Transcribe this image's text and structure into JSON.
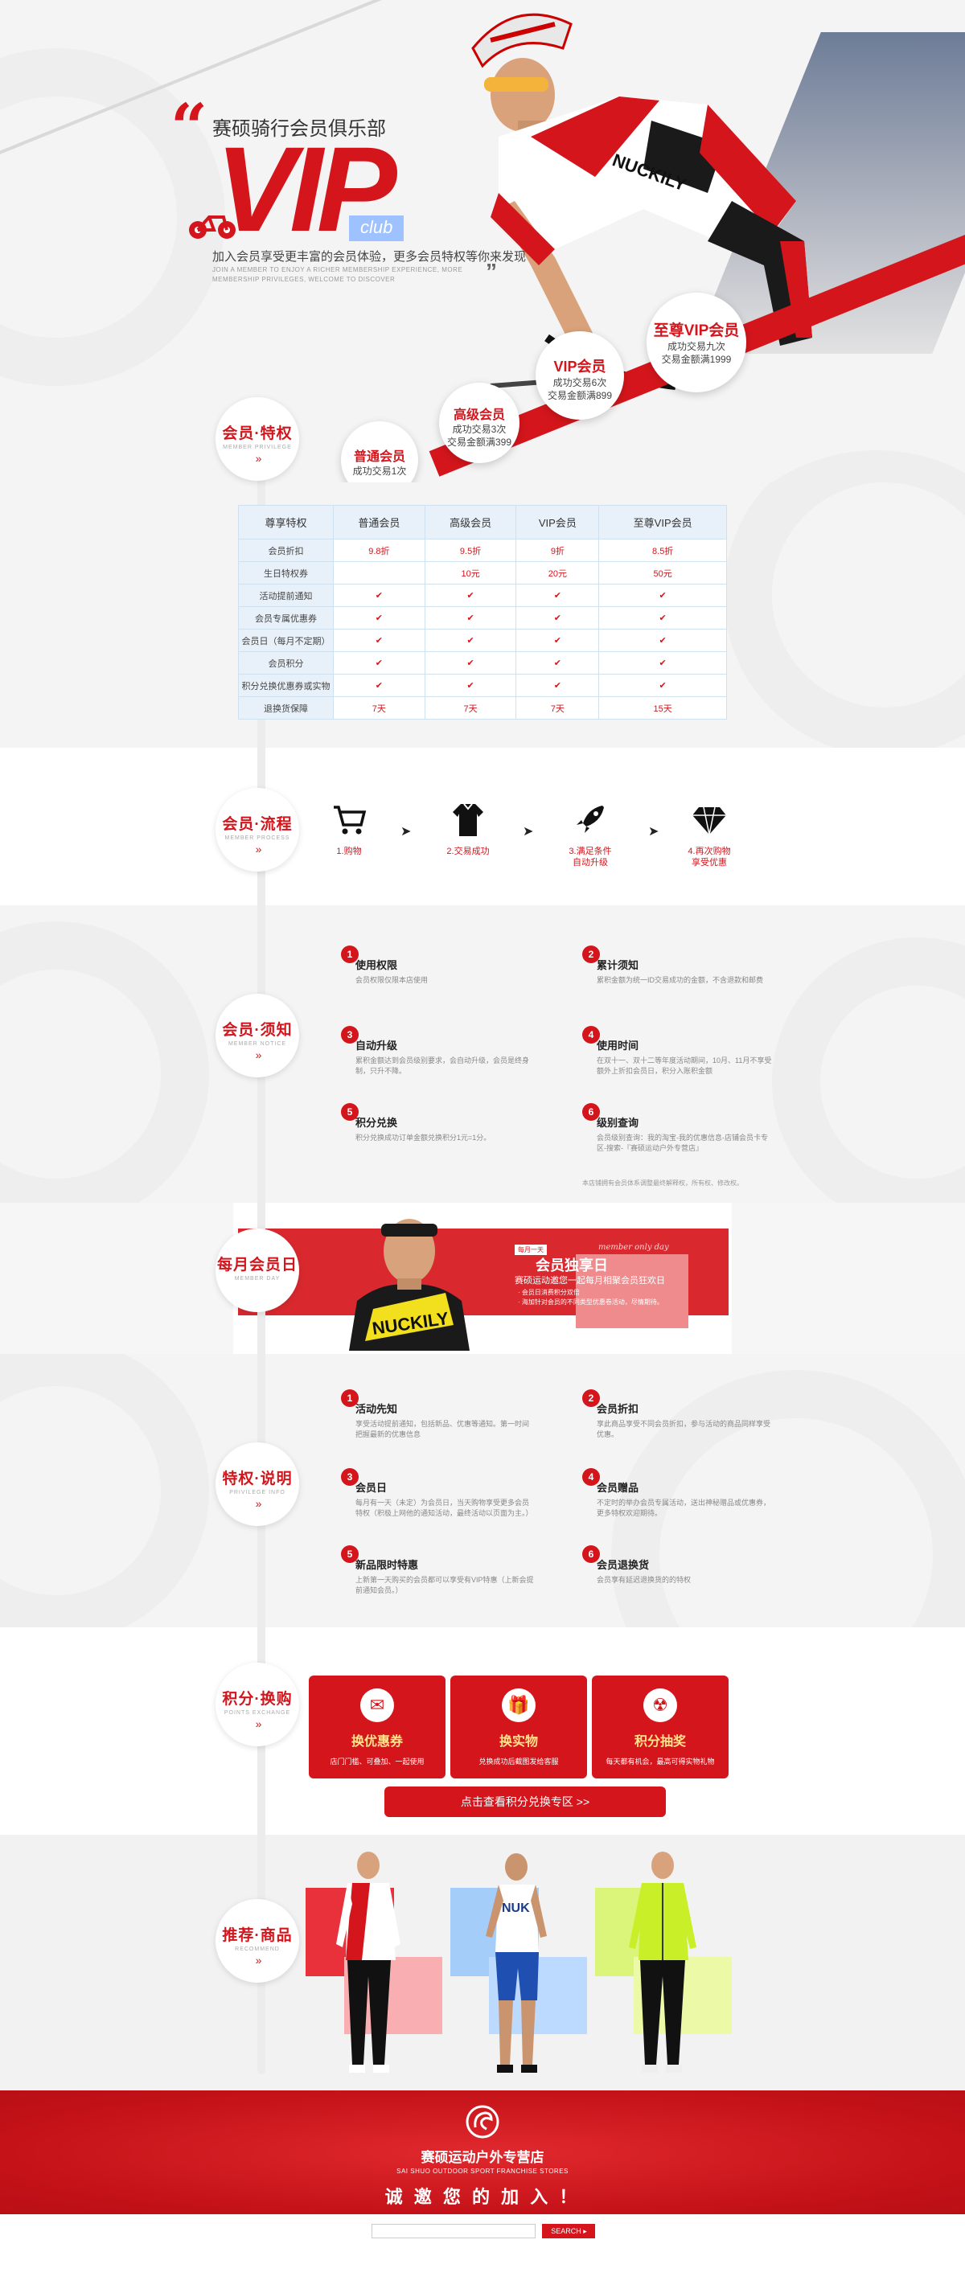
{
  "hero": {
    "subtitle": "赛硕骑行会员俱乐部",
    "vip": "VIP",
    "club": "club",
    "desc": "加入会员享受更丰富的会员体验，更多会员特权等你来发现",
    "en": "JOIN A MEMBER TO ENJOY A RICHER MEMBERSHIP EXPERIENCE, MORE MEMBERSHIP PRIVILEGES, WELCOME TO DISCOVER"
  },
  "levels": [
    {
      "name": "普通会员",
      "desc1": "成功交易1次",
      "desc2": ""
    },
    {
      "name": "高级会员",
      "desc1": "成功交易3次",
      "desc2": "交易金额满399"
    },
    {
      "name": "VIP会员",
      "desc1": "成功交易6次",
      "desc2": "交易金额满899"
    },
    {
      "name": "至尊VIP会员",
      "desc1": "成功交易九次",
      "desc2": "交易金额满1999"
    }
  ],
  "section_tags": {
    "privilege": {
      "a": "会员",
      "b": "特权",
      "en": "MEMBER PRIVILEGE"
    },
    "process": {
      "a": "会员",
      "b": "流程",
      "en": "MEMBER PROCESS"
    },
    "notice": {
      "a": "会员",
      "b": "须知",
      "en": "MEMBER NOTICE"
    },
    "monthly": {
      "a": "每月",
      "b": "会员日",
      "en": "MEMBER DAY"
    },
    "explain": {
      "a": "特权",
      "b": "说明",
      "en": "PRIVILEGE INFO"
    },
    "points": {
      "a": "积分",
      "b": "换购",
      "en": "POINTS EXCHANGE"
    },
    "recommend": {
      "a": "推荐",
      "b": "商品",
      "en": "RECOMMEND"
    },
    "arrows": "»"
  },
  "table": {
    "headers": [
      "尊享特权",
      "普通会员",
      "高级会员",
      "VIP会员",
      "至尊VIP会员"
    ],
    "rows": [
      [
        "会员折扣",
        "9.8折",
        "9.5折",
        "9折",
        "8.5折"
      ],
      [
        "生日特权券",
        "",
        "10元",
        "20元",
        "50元"
      ],
      [
        "活动提前通知",
        "✔",
        "✔",
        "✔",
        "✔"
      ],
      [
        "会员专属优惠券",
        "✔",
        "✔",
        "✔",
        "✔"
      ],
      [
        "会员日（每月不定期）",
        "✔",
        "✔",
        "✔",
        "✔"
      ],
      [
        "会员积分",
        "✔",
        "✔",
        "✔",
        "✔"
      ],
      [
        "积分兑换优惠券或实物",
        "✔",
        "✔",
        "✔",
        "✔"
      ],
      [
        "退换货保障",
        "7天",
        "7天",
        "7天",
        "15天"
      ]
    ]
  },
  "process": {
    "steps": [
      {
        "label1": "1.购物",
        "label2": ""
      },
      {
        "label1": "2.交易成功",
        "label2": ""
      },
      {
        "label1": "3.满足条件",
        "label2": "自动升级"
      },
      {
        "label1": "4.再次购物",
        "label2": "享受优惠"
      }
    ],
    "arrow": "➤"
  },
  "notices": [
    {
      "num": "1",
      "title": "使用权限",
      "text": "会员权限仅限本店使用"
    },
    {
      "num": "2",
      "title": "累计须知",
      "text": "累积金额为统一ID交易成功的金额，不含退款和邮费"
    },
    {
      "num": "3",
      "title": "自动升级",
      "text": "累积金额达到会员级别要求，会自动升级，会员是终身制，只升不降。"
    },
    {
      "num": "4",
      "title": "使用时间",
      "text": "在双十一、双十二等年度活动期间，10月、11月不享受额外上折扣会员日，积分入账积金额"
    },
    {
      "num": "5",
      "title": "积分兑换",
      "text": "积分兑换成功订单金额兑换积分1元=1分。"
    },
    {
      "num": "6",
      "title": "级别查询",
      "text": "会员级别查询：我的淘宝-我的优惠信息-店铺会员卡专区-搜索-『赛硕运动户外专营店』"
    }
  ],
  "notice_footnote": "本店铺拥有会员体系调整最终解释权，所有权、修改权。",
  "member_day": {
    "tag": "每月一天",
    "script": "member only day",
    "title": "会员独享日",
    "line1": "赛硕运动邀您一起每月相聚会员狂欢日",
    "b1": "· 会员日消费积分双倍",
    "b2": "· 海加针对会员的不同类型优惠卷活动，尽情期待。"
  },
  "explain": [
    {
      "num": "1",
      "title": "活动先知",
      "text": "享受活动提前通知，包括新品、优惠等通知。第一时间把握最新的优惠信息"
    },
    {
      "num": "2",
      "title": "会员折扣",
      "text": "享此商品享受不同会员折扣，参与活动的商品同样享受优惠。"
    },
    {
      "num": "3",
      "title": "会员日",
      "text": "每月有一天（未定）为会员日，当天购物享受更多会员特权（积极上网他的通知活动，最终活动以页面为主。）"
    },
    {
      "num": "4",
      "title": "会员赠品",
      "text": "不定时的举办会员专属活动，送出神秘赠品或优惠券，更多特权欢迎期待。"
    },
    {
      "num": "5",
      "title": "新品限时特惠",
      "text": "上新第一天购买的会员都可以享受有VIP特惠（上新会提前通知会员。）"
    },
    {
      "num": "6",
      "title": "会员退换货",
      "text": "会员享有延迟退换货的的特权"
    }
  ],
  "points": {
    "cards": [
      {
        "title": "换优惠券",
        "sub": "店门门槛、可叠加、一起使用",
        "icon": "✉"
      },
      {
        "title": "换实物",
        "sub": "兑换成功后截图发给客服",
        "icon": "🎁"
      },
      {
        "title": "积分抽奖",
        "sub": "每天都有机会，最高可得实物礼物",
        "icon": "☢"
      }
    ],
    "button": "点击查看积分兑换专区 >>"
  },
  "footer": {
    "store": "赛硕运动户外专营店",
    "store_en": "SAI SHUO OUTDOOR SPORT FRANCHISE STORES",
    "slogan": "诚 邀 您 的 加 入 ！"
  },
  "search": {
    "placeholder": "",
    "button": "SEARCH ▸"
  },
  "colors": {
    "brand": "#d4161c",
    "blue": "#9ec2ff"
  }
}
